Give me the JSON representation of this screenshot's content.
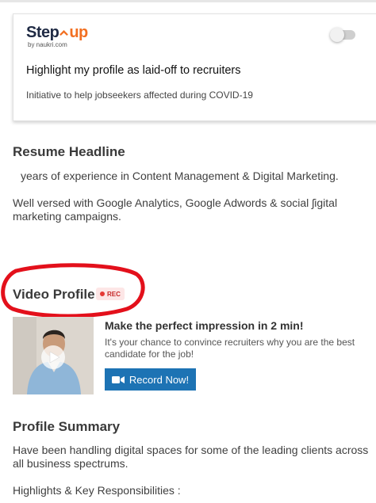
{
  "stepup_card": {
    "logo_prefix": "Step",
    "logo_suffix": "up",
    "logo_sub": "by naukri.com",
    "title": "Highlight my profile as laid-off to recruiters",
    "subtitle": "Initiative to help jobseekers affected during COVID-19",
    "toggle_on": false
  },
  "resume_headline": {
    "heading": "Resume Headline",
    "line1": "years of experience in Content Management & Digital Marketing.",
    "line2": "Well versed with Google Analytics, Google Adwords & social ʃigital",
    "line3": "marketing campaigns."
  },
  "video_profile": {
    "heading": "Video Profile",
    "badge": "REC",
    "title": "Make the perfect impression in 2 min!",
    "description": "It's your chance to convince recruiters why you are the best candidate for the job!",
    "button_label": "Record Now!",
    "accent_color": "#1d73b4",
    "highlight_color": "#e3101b"
  },
  "profile_summary": {
    "heading": "Profile Summary",
    "line1": "Have been handling digital spaces for some of the leading clients across",
    "line2": "all business spectrums.",
    "line3": "Highlights & Key Responsibilities :"
  }
}
